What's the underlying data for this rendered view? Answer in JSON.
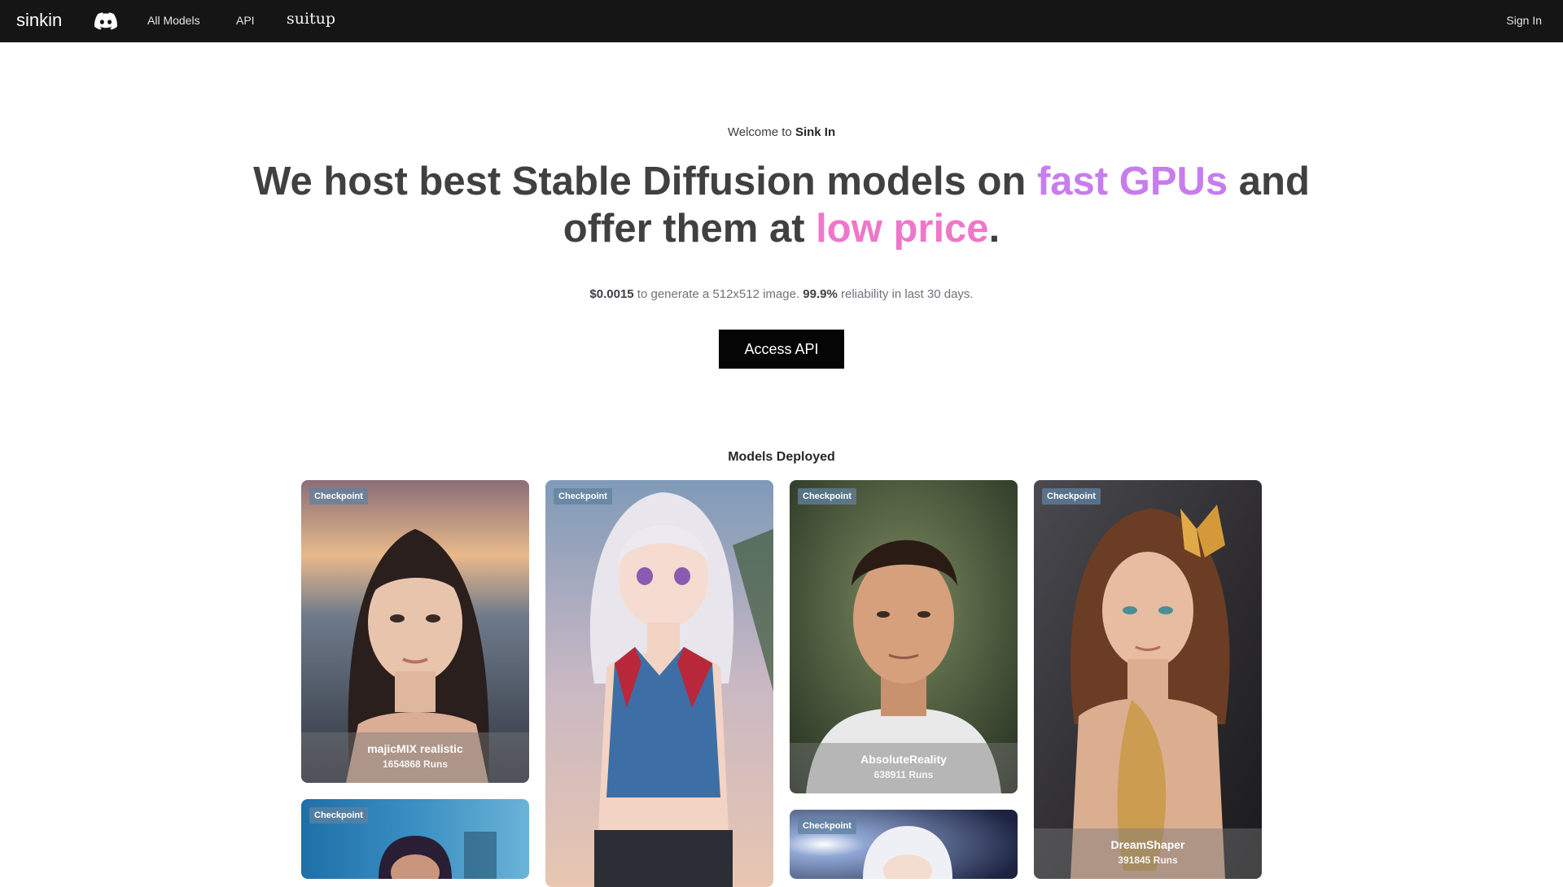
{
  "nav": {
    "brand": "sinkin",
    "links": [
      "All Models",
      "API"
    ],
    "sponsor": "suitup",
    "signin": "Sign In"
  },
  "hero": {
    "welcome_prefix": "Welcome to ",
    "welcome_name": "Sink In",
    "headline_1": "We host best Stable Diffusion models on ",
    "headline_highlight_1": "fast GPUs",
    "headline_2": " and offer them at ",
    "headline_highlight_2": "low price",
    "headline_3": ".",
    "price": "$0.0015",
    "sub_1": " to generate a 512x512 image. ",
    "reliability": "99.9%",
    "sub_2": " reliability in last 30 days.",
    "cta": "Access API"
  },
  "models_section": {
    "title": "Models Deployed",
    "cards": [
      {
        "badge": "Checkpoint",
        "name": "majicMIX realistic",
        "runs": "1654868 Runs"
      },
      {
        "badge": "Checkpoint",
        "name": "",
        "runs": ""
      },
      {
        "badge": "Checkpoint",
        "name": "AbsoluteReality",
        "runs": "638911 Runs"
      },
      {
        "badge": "Checkpoint",
        "name": "DreamShaper",
        "runs": "391845 Runs"
      },
      {
        "badge": "Checkpoint",
        "name": "",
        "runs": ""
      },
      {
        "badge": "Checkpoint",
        "name": "",
        "runs": ""
      }
    ]
  },
  "colors": {
    "nav_bg": "#151515",
    "accent_purple": "#c77ded",
    "accent_pink": "#ee77c9",
    "cta_bg": "#050505"
  }
}
